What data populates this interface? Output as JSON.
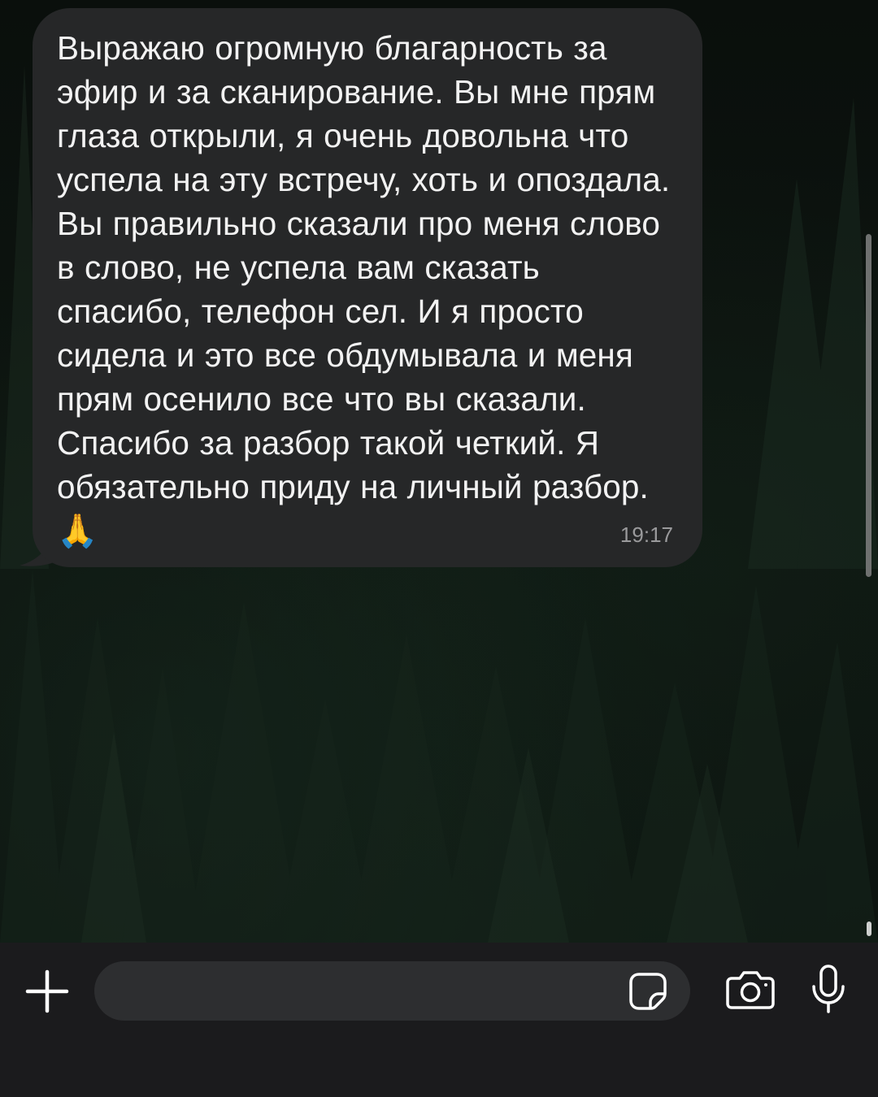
{
  "message": {
    "text": "Выражаю огромную благарность за эфир и за сканирование. Вы мне прям глаза открыли, я очень довольна что успела на эту встречу, хоть и опоздала. Вы правильно сказали про меня слово в слово, не успела вам сказать спасибо, телефон сел. И я просто сидела и это все обдумывала и меня прям осенило все что вы сказали. Спасибо за разбор такой четкий. Я обязательно приду на личный разбор. 🙏",
    "time": "19:17"
  },
  "input": {
    "placeholder": "",
    "value": ""
  },
  "icons": {
    "attach": "plus-icon",
    "sticker": "sticker-icon",
    "camera": "camera-icon",
    "microphone": "microphone-icon"
  },
  "colors": {
    "bubble": "#262728",
    "text": "#f2f2f2",
    "timestamp": "#9a9a9c",
    "input_bar": "#1b1b1d",
    "input_field": "#2d2e30"
  }
}
